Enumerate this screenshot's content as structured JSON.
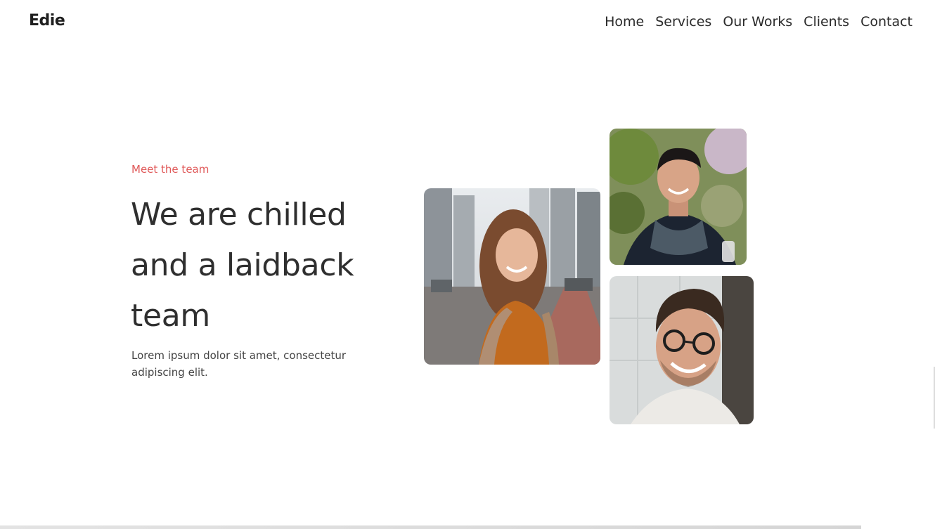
{
  "header": {
    "logo": "Edie",
    "nav": [
      "Home",
      "Services",
      "Our Works",
      "Clients",
      "Contact"
    ]
  },
  "hero": {
    "eyebrow": "Meet the team",
    "headline": "We are chilled and a laidback team",
    "subtext": "Lorem ipsum dolor sit amet, consectetur adipiscing elit."
  },
  "colors": {
    "accent": "#e05a5a",
    "text": "#2f2f2f",
    "background": "#ffffff"
  }
}
